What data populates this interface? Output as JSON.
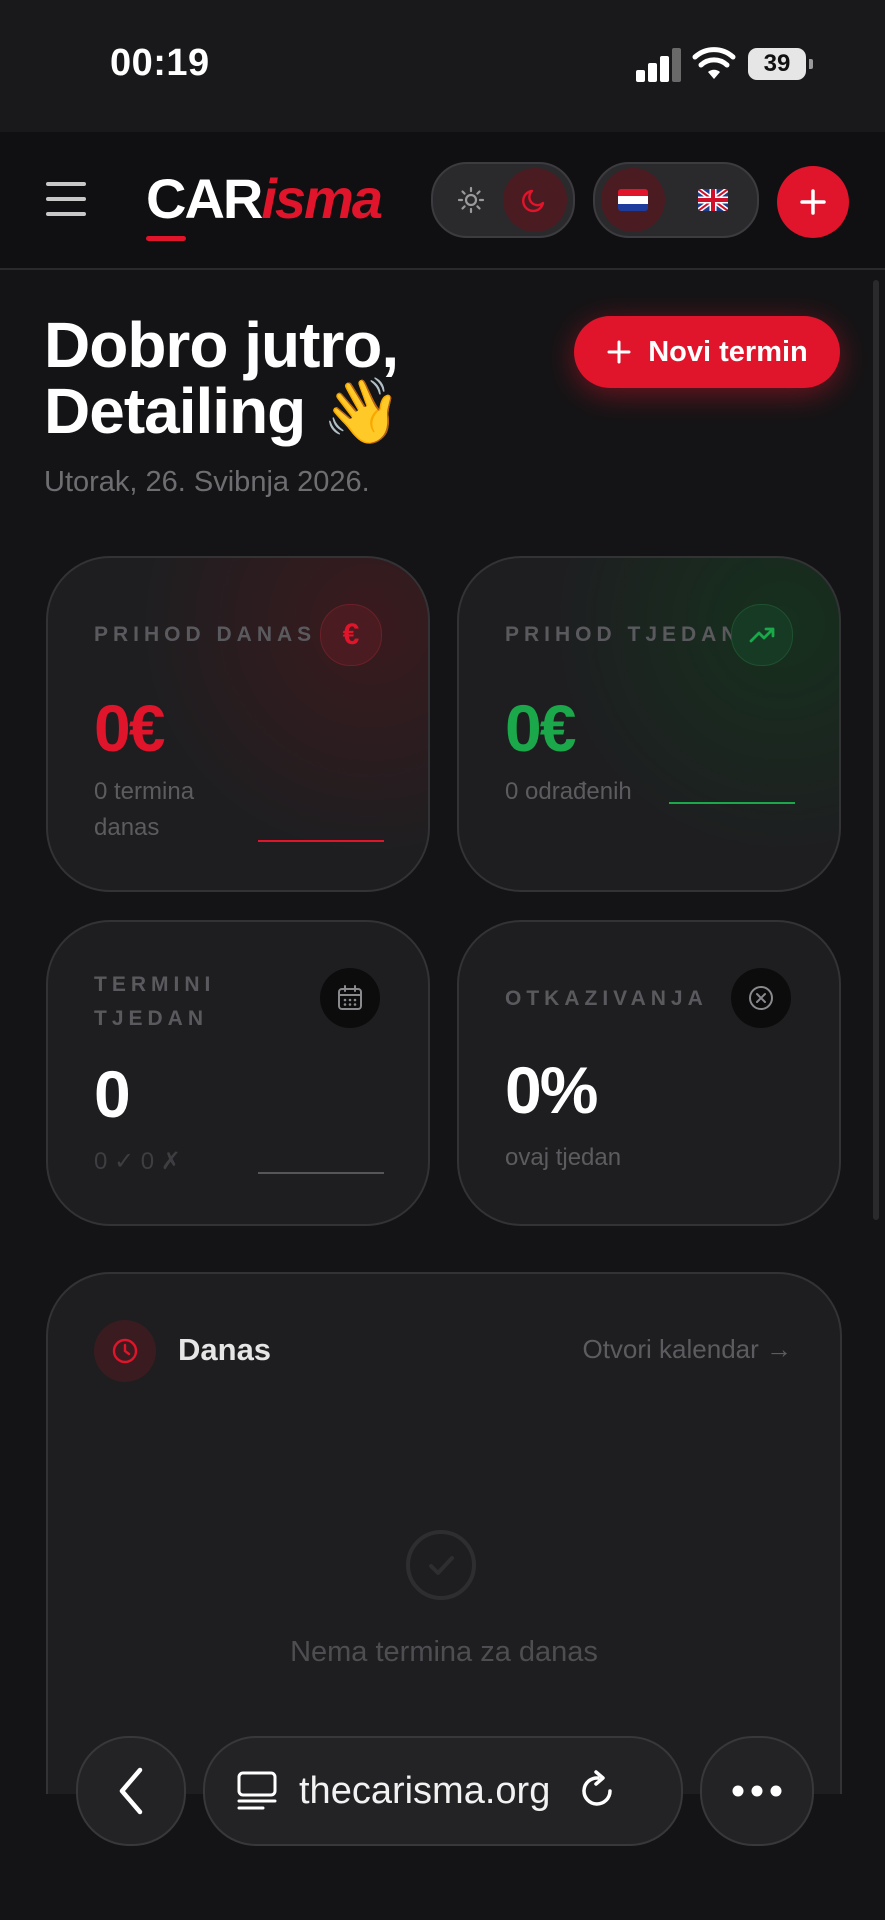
{
  "status_bar": {
    "time": "00:19",
    "battery": "39"
  },
  "header": {
    "logo_main": "CAR",
    "logo_accent": "isma",
    "theme_options": [
      "light",
      "dark"
    ],
    "theme_selected": "dark",
    "languages": [
      "hr",
      "en"
    ],
    "language_selected": "hr"
  },
  "greeting": {
    "line1": "Dobro jutro,",
    "line2": "Detailing 👋",
    "date": "Utorak, 26. Svibnja 2026."
  },
  "new_appointment_label": "Novi termin",
  "stats": [
    {
      "label": "PRIHOD DANAS",
      "value": "0€",
      "sub": "0 termina danas",
      "color": "#e0142a",
      "icon": "euro-icon"
    },
    {
      "label": "PRIHOD TJEDAN",
      "value": "0€",
      "sub": "0 odrađenih",
      "color": "#1aa84a",
      "icon": "trending-up-icon"
    },
    {
      "label": "TERMINI TJEDAN",
      "value": "0",
      "sub": "0 ✓ 0 ✗",
      "color": "#ffffff",
      "icon": "calendar-icon"
    },
    {
      "label": "OTKAZIVANJA",
      "value": "0%",
      "sub": "ovaj tjedan",
      "color": "#ffffff",
      "icon": "cancel-circle-icon"
    }
  ],
  "today": {
    "title": "Danas",
    "calendar_link": "Otvori kalendar →",
    "empty_message": "Nema termina za danas"
  },
  "browser": {
    "url": "thecarisma.org"
  }
}
